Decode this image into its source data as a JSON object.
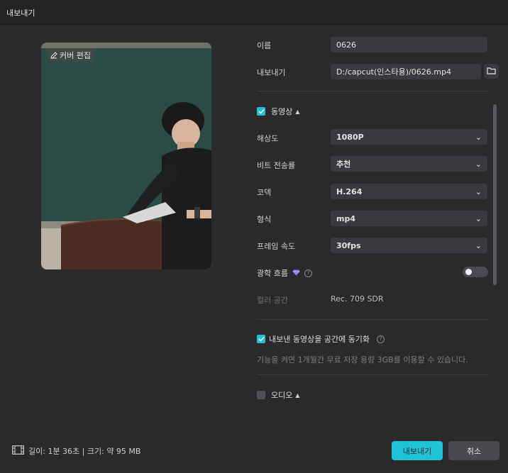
{
  "window": {
    "title": "내보내기"
  },
  "preview": {
    "cover_edit_label": "커버 편집"
  },
  "form": {
    "name_label": "이름",
    "name_value": "0626",
    "export_label": "내보내기",
    "export_path": "D:/capcut(인스타용)/0626.mp4"
  },
  "video": {
    "section_label": "동영상",
    "checked": true,
    "resolution_label": "해상도",
    "resolution_value": "1080P",
    "bitrate_label": "비트 전송률",
    "bitrate_value": "추천",
    "codec_label": "코덱",
    "codec_value": "H.264",
    "format_label": "형식",
    "format_value": "mp4",
    "framerate_label": "프레임 속도",
    "framerate_value": "30fps",
    "optical_flow_label": "광학 흐름",
    "optical_flow_on": false,
    "color_space_label": "컬러 공간",
    "color_space_value": "Rec. 709 SDR"
  },
  "sync": {
    "label": "내보낸 동영상을 공간에 동기화",
    "checked": true,
    "description": "기능을 켜면 1개월간 무료 저장 용량 3GB를 이용할 수 있습니다."
  },
  "audio": {
    "section_label": "오디오",
    "checked": false
  },
  "footer": {
    "info": "길이: 1분 36초 | 크기: 약 95 MB",
    "export_button": "내보내기",
    "cancel_button": "취소"
  },
  "colors": {
    "accent": "#1fc3d6",
    "background": "#2a2a2d",
    "field": "#3a3a3e"
  },
  "icons": {
    "edit": "pencil-icon",
    "folder": "folder-icon",
    "check": "checkmark-icon",
    "chevron": "chevron-down-icon",
    "premium": "diamond-icon",
    "info": "info-icon",
    "film": "film-icon"
  }
}
